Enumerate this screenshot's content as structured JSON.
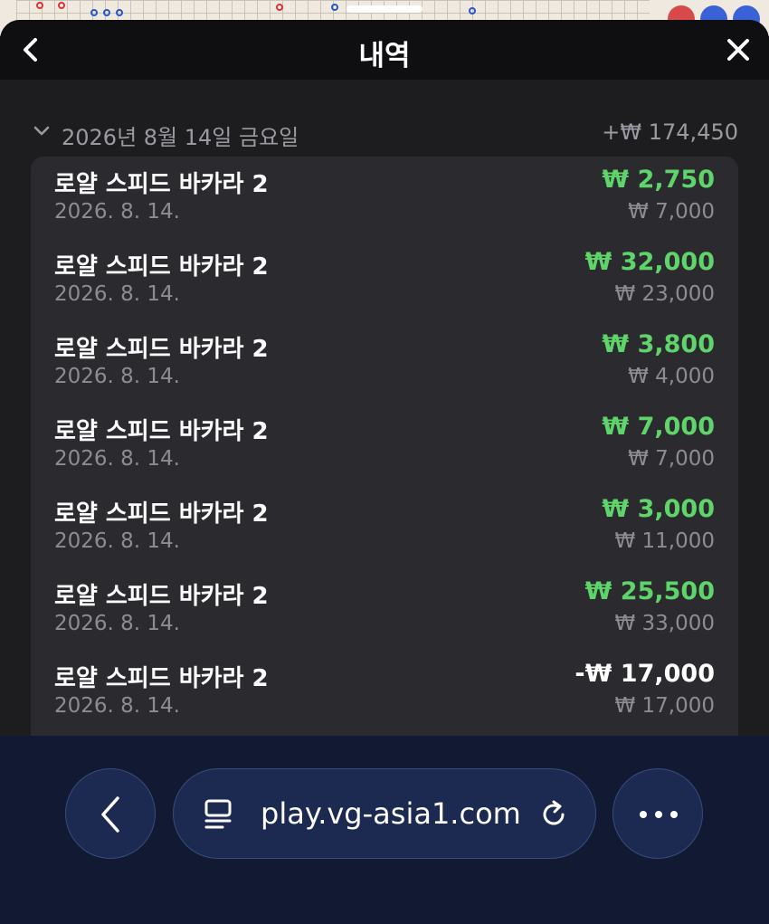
{
  "header": {
    "title": "내역",
    "back_icon": "chevron-left-icon",
    "close_icon": "close-icon"
  },
  "day_group": {
    "date": "2026년 8월 14일 금요일",
    "total": "+₩ 174,450",
    "expand_icon": "chevron-down-icon"
  },
  "transactions": [
    {
      "name": "로얄 스피드 바카라 2",
      "date": "2026. 8. 14.",
      "result": "₩ 2,750",
      "bet": "₩ 7,000",
      "type": "win"
    },
    {
      "name": "로얄 스피드 바카라 2",
      "date": "2026. 8. 14.",
      "result": "₩ 32,000",
      "bet": "₩ 23,000",
      "type": "win"
    },
    {
      "name": "로얄 스피드 바카라 2",
      "date": "2026. 8. 14.",
      "result": "₩ 3,800",
      "bet": "₩ 4,000",
      "type": "win"
    },
    {
      "name": "로얄 스피드 바카라 2",
      "date": "2026. 8. 14.",
      "result": "₩ 7,000",
      "bet": "₩ 7,000",
      "type": "win"
    },
    {
      "name": "로얄 스피드 바카라 2",
      "date": "2026. 8. 14.",
      "result": "₩ 3,000",
      "bet": "₩ 11,000",
      "type": "win"
    },
    {
      "name": "로얄 스피드 바카라 2",
      "date": "2026. 8. 14.",
      "result": "₩ 25,500",
      "bet": "₩ 33,000",
      "type": "win"
    },
    {
      "name": "로얄 스피드 바카라 2",
      "date": "2026. 8. 14.",
      "result": "-₩ 17,000",
      "bet": "₩ 17,000",
      "type": "loss"
    }
  ],
  "browser": {
    "url": "play.vg-asia1.com",
    "back_icon": "chevron-left-icon",
    "page_icon": "page-icon",
    "reload_icon": "reload-icon",
    "more_icon": "more-icon"
  },
  "colors": {
    "win": "#5fd46a",
    "loss": "#ffffff",
    "header_bg": "#0f0f11",
    "list_bg": "#2b2b2f",
    "browser_bg": "#121a33"
  }
}
